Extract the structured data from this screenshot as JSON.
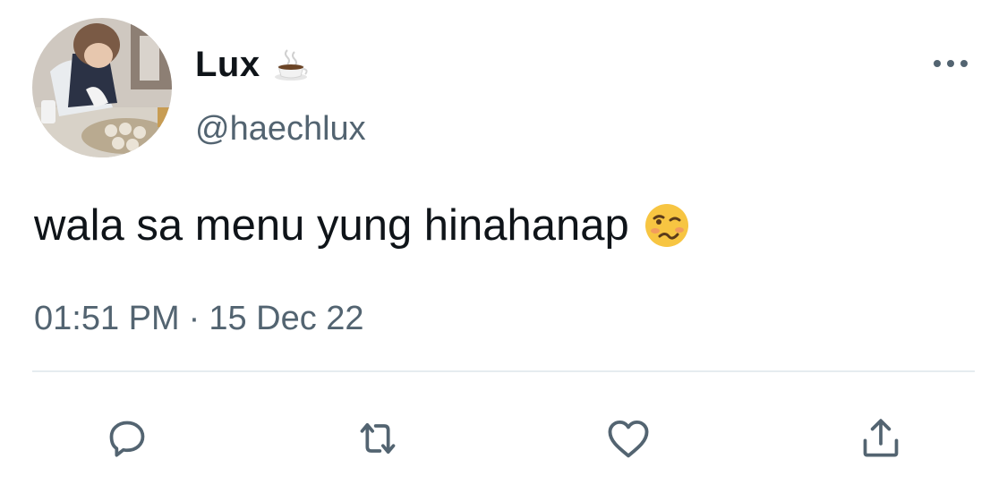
{
  "tweet": {
    "display_name": "Lux",
    "name_emoji": "coffee-cup-icon",
    "handle": "@haechlux",
    "text": "wala sa menu yung hinahanap",
    "text_emoji": "woozy-face-icon",
    "time": "01:51 PM",
    "separator": "·",
    "date": "15 Dec 22"
  },
  "actions": {
    "icons": [
      "reply-icon",
      "retweet-icon",
      "like-icon",
      "share-icon"
    ]
  },
  "colors": {
    "text_primary": "#0f1419",
    "text_secondary": "#536471",
    "icon": "#536471",
    "divider": "#e6ecf0"
  }
}
